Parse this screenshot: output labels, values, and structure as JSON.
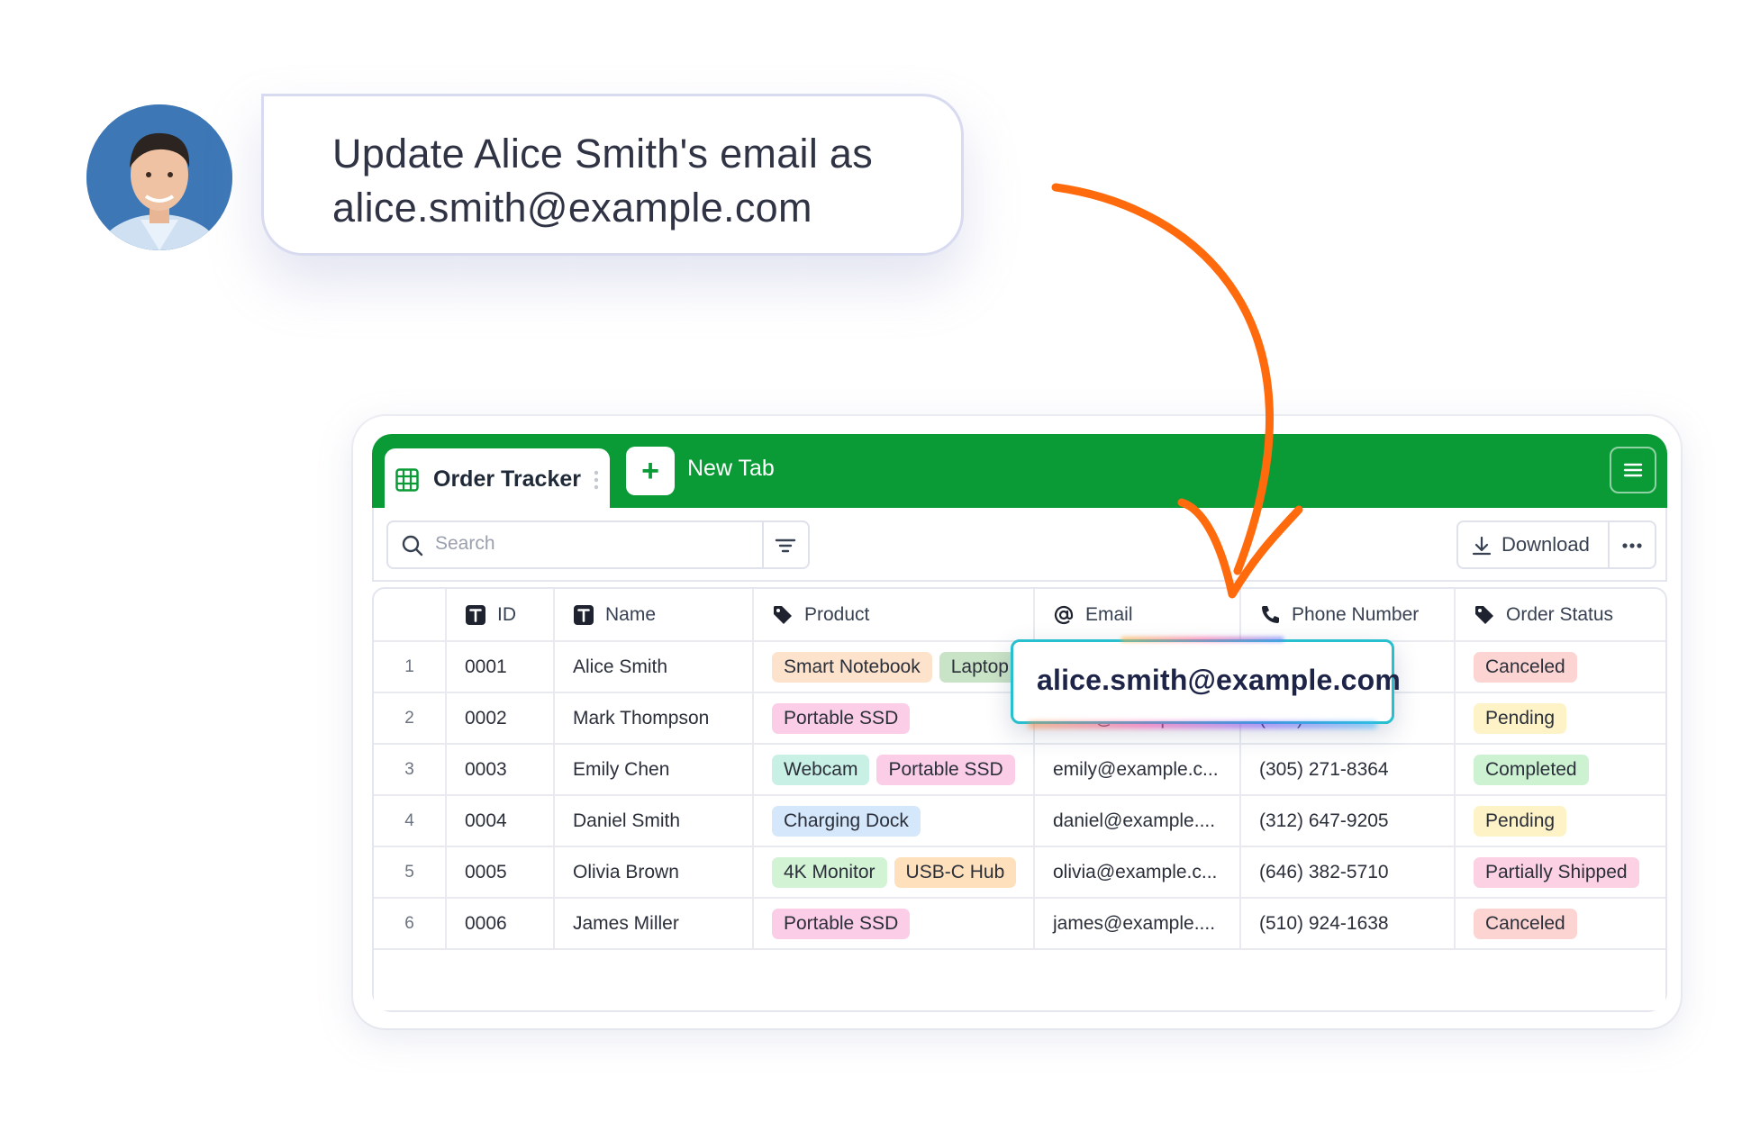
{
  "instruction": {
    "line1": "Update Alice Smith's email as",
    "line2": "alice.smith@example.com"
  },
  "tabs": {
    "active_label": "Order Tracker",
    "new_tab_label": "New Tab",
    "add_symbol": "+"
  },
  "toolbar": {
    "search_placeholder": "Search",
    "download_label": "Download"
  },
  "table": {
    "columns": [
      "ID",
      "Name",
      "Product",
      "Email",
      "Phone Number",
      "Order Status"
    ],
    "rows": [
      {
        "num": "1",
        "id": "0001",
        "name": "Alice Smith",
        "products": [
          "Smart Notebook",
          "Laptop"
        ],
        "email": "",
        "phone": "",
        "status": "Canceled"
      },
      {
        "num": "2",
        "id": "0002",
        "name": "Mark Thompson",
        "products": [
          "Portable SSD"
        ],
        "email": "mark@example.c...",
        "phone": "(415) 555-0142",
        "status": "Pending"
      },
      {
        "num": "3",
        "id": "0003",
        "name": "Emily Chen",
        "products": [
          "Webcam",
          "Portable SSD"
        ],
        "email": "emily@example.c...",
        "phone": "(305) 271-8364",
        "status": "Completed"
      },
      {
        "num": "4",
        "id": "0004",
        "name": "Daniel Smith",
        "products": [
          "Charging Dock"
        ],
        "email": "daniel@example....",
        "phone": "(312) 647-9205",
        "status": "Pending"
      },
      {
        "num": "5",
        "id": "0005",
        "name": "Olivia Brown",
        "products": [
          "4K Monitor",
          "USB-C Hub"
        ],
        "email": "olivia@example.c...",
        "phone": "(646) 382-5710",
        "status": "Partially Shipped"
      },
      {
        "num": "6",
        "id": "0006",
        "name": "James Miller",
        "products": [
          "Portable SSD"
        ],
        "email": "james@example....",
        "phone": "(510) 924-1638",
        "status": "Canceled"
      }
    ]
  },
  "edit_popup": {
    "value": "alice.smith@example.com"
  },
  "colors": {
    "brand_green": "#0a9b37",
    "arrow_orange": "#ff6a0d",
    "popup_border": "#28c0cf"
  },
  "icons": [
    "grid-icon",
    "drag-handle-icon",
    "plus-icon",
    "hamburger-menu-icon",
    "search-icon",
    "filter-icon",
    "download-icon",
    "more-icon",
    "text-type-icon",
    "tag-icon",
    "at-sign-icon",
    "phone-icon"
  ]
}
